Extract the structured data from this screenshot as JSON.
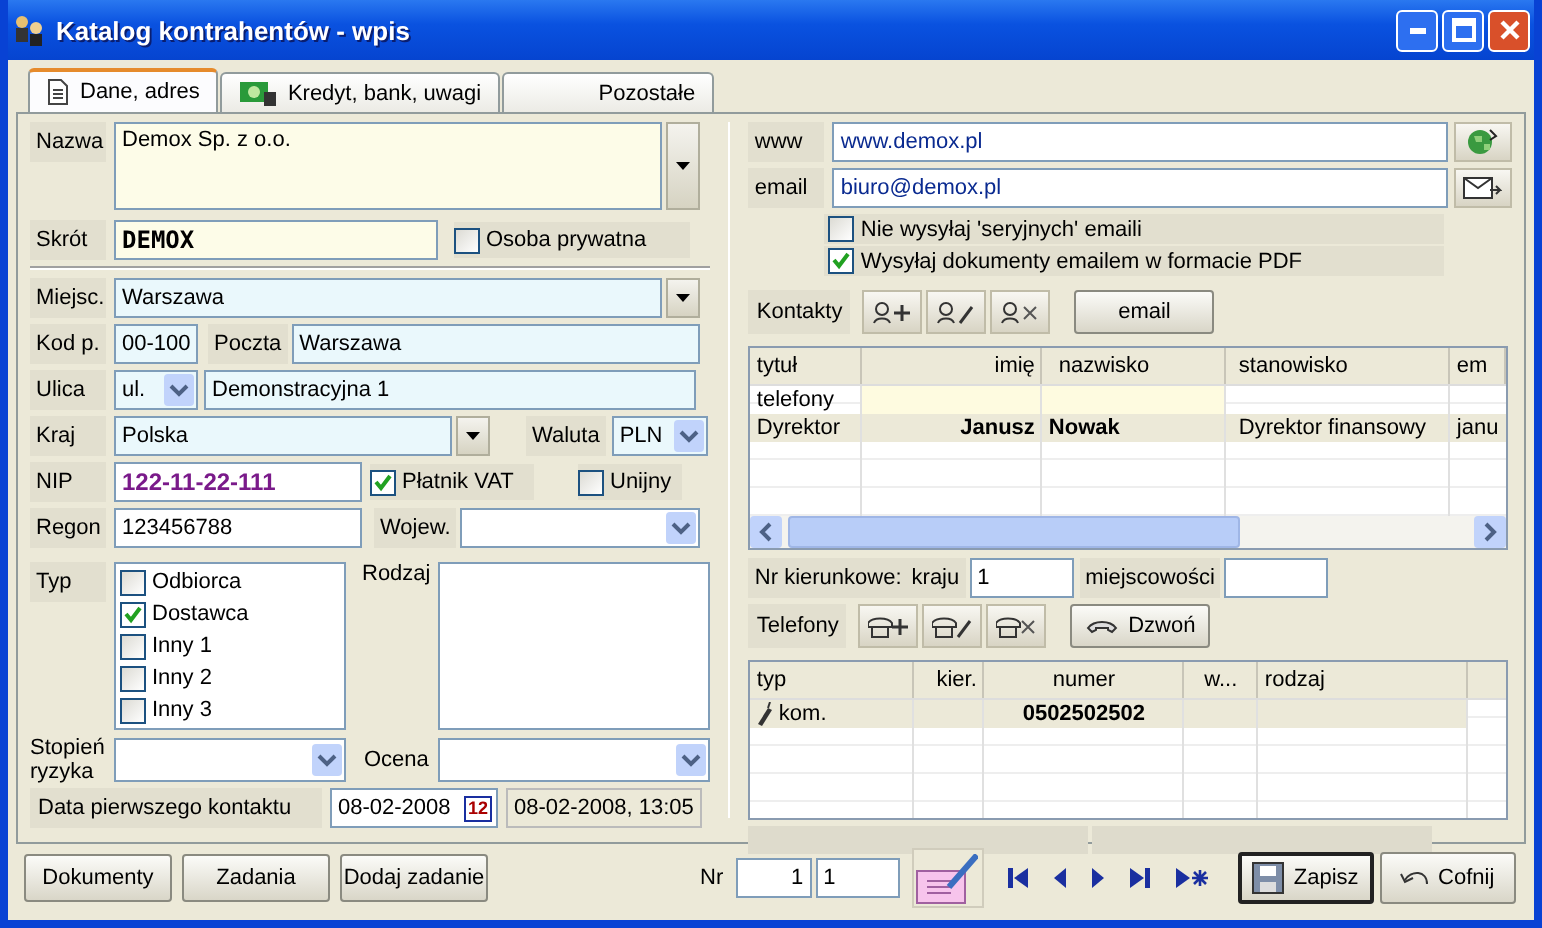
{
  "window": {
    "title": "Katalog kontrahentów - wpis"
  },
  "tabs": [
    {
      "label": "Dane, adres",
      "selected": true,
      "kind": "document"
    },
    {
      "label": "Kredyt, bank, uwagi",
      "selected": false,
      "kind": "money"
    },
    {
      "label": "Pozostałe",
      "selected": false,
      "kind": "plain"
    }
  ],
  "left": {
    "name": {
      "label": "Nazwa",
      "value": "Demox Sp. z o.o."
    },
    "short": {
      "label": "Skrót",
      "value": "DEMOX"
    },
    "private": {
      "label": "Osoba prywatna",
      "checked": false
    },
    "city": {
      "label": "Miejsc.",
      "value": "Warszawa"
    },
    "postal": {
      "label": "Kod p.",
      "value": "00-100"
    },
    "post": {
      "label": "Poczta",
      "value": "Warszawa"
    },
    "street": {
      "label": "Ulica",
      "prefix": "ul.",
      "value": "Demonstracyjna 1"
    },
    "country": {
      "label": "Kraj",
      "value": "Polska"
    },
    "currency": {
      "label": "Waluta",
      "value": "PLN"
    },
    "nip": {
      "label": "NIP",
      "value": "122-11-22-111"
    },
    "vat": {
      "label": "Płatnik VAT",
      "checked": true
    },
    "eu": {
      "label": "Unijny",
      "checked": false
    },
    "regon": {
      "label": "Regon",
      "value": "123456788"
    },
    "voivodeship": {
      "label": "Wojew."
    },
    "type": {
      "label": "Typ",
      "options": [
        {
          "label": "Odbiorca",
          "checked": false
        },
        {
          "label": "Dostawca",
          "checked": true
        },
        {
          "label": "Inny 1",
          "checked": false
        },
        {
          "label": "Inny 2",
          "checked": false
        },
        {
          "label": "Inny 3",
          "checked": false
        }
      ]
    },
    "category": {
      "label": "Rodzaj"
    },
    "risk": {
      "label": "Stopień ryzyka"
    },
    "rating": {
      "label": "Ocena"
    },
    "first_contact": {
      "label": "Data pierwszego kontaktu",
      "value": "08-02-2008",
      "calendar_day": "12",
      "stamp": "08-02-2008, 13:05"
    }
  },
  "right": {
    "www": {
      "label": "www",
      "value": "www.demox.pl"
    },
    "email": {
      "label": "email",
      "value": "biuro@demox.pl"
    },
    "options": [
      {
        "label": "Nie wysyłaj 'seryjnych' emaili",
        "checked": false
      },
      {
        "label": "Wysyłaj dokumenty emailem w formacie PDF",
        "checked": true
      }
    ],
    "contacts": {
      "label": "Kontakty",
      "email_button": "email",
      "columns": [
        "tytuł",
        "imię",
        "nazwisko",
        "stanowisko",
        "em"
      ],
      "filter_label": "telefony",
      "rows": [
        [
          "Dyrektor",
          "Janusz",
          "Nowak",
          "Dyrektor finansowy",
          "janu"
        ]
      ]
    },
    "codes": {
      "label": "Nr kierunkowe:",
      "country_label": "kraju",
      "country_value": "1",
      "city_label": "miejscowości"
    },
    "phones": {
      "label": "Telefony",
      "call_button": "Dzwoń",
      "columns": [
        "typ",
        "kier.",
        "numer",
        "w...",
        "rodzaj"
      ],
      "rows": [
        [
          "kom.",
          "",
          "0502502502",
          "",
          ""
        ]
      ]
    }
  },
  "footer": {
    "buttons": [
      "Dokumenty",
      "Zadania",
      "Dodaj zadanie"
    ],
    "nr_label": "Nr",
    "nr_value": "1",
    "nr_total": "1",
    "save": "Zapisz",
    "undo": "Cofnij"
  }
}
